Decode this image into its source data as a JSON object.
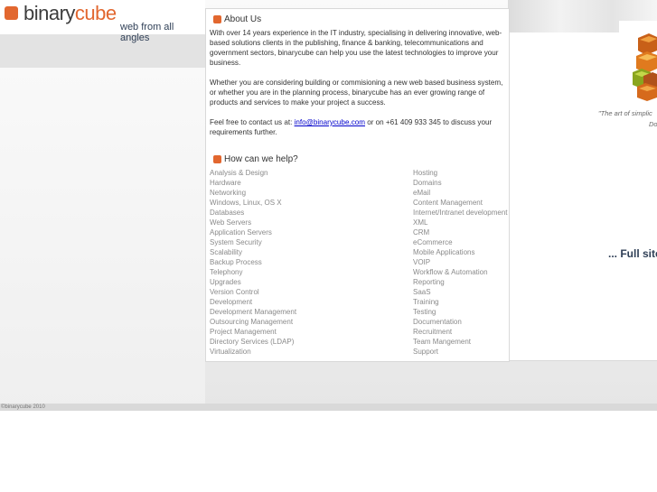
{
  "logo": {
    "word_part1": "binary",
    "word_part2": "cube",
    "tagline": "web from all angles"
  },
  "about": {
    "heading": "About Us",
    "paragraph1": "With over 14 years experience in the IT industry, specialising in delivering innovative, web-based solutions clients in the publishing, finance & banking, telecommunications and government sectors, binarycube can help you use the latest technologies to improve your business.",
    "paragraph2": "Whether you are considering building or commisioning a new web based business system, or whether you are in the planning process, binarycube has an ever growing range of products and services to make your project a success.",
    "contact_prefix": "Feel free to contact us at: ",
    "contact_email": "info@binarycube.com",
    "contact_suffix": " or on +61 409 933 345 to discuss your requirements further."
  },
  "help": {
    "heading": "How can we help?",
    "column1": [
      "Analysis & Design",
      "Hardware",
      "Networking",
      "Windows, Linux, OS X",
      "Databases",
      "Web Servers",
      "Application Servers",
      "System Security",
      "Scalability",
      "Backup Process",
      "Telephony",
      "Upgrades",
      "Version Control",
      "Development",
      "Development Management",
      "Outsourcing Management",
      "Project Management",
      "Directory Services (LDAP)",
      "Virtualization"
    ],
    "column2": [
      "Hosting",
      "Domains",
      "eMail",
      "Content Management",
      "Internet/Intranet development",
      "XML",
      "CRM",
      "eCommerce",
      "Mobile Applications",
      "VOIP",
      "Workflow & Automation",
      "Reporting",
      "SaaS",
      "Training",
      "Testing",
      "Documentation",
      "Recruitment",
      "Team Mangement",
      "Support"
    ]
  },
  "sidebar": {
    "quote_line1": "\"The art of simplic",
    "quote_line2": "Do",
    "full_site": "... Full site"
  },
  "footer": {
    "copyright": "©binarycube 2010"
  },
  "colors": {
    "accent": "#e2672f",
    "navy": "#2f3f56",
    "link": "#0000cc"
  }
}
